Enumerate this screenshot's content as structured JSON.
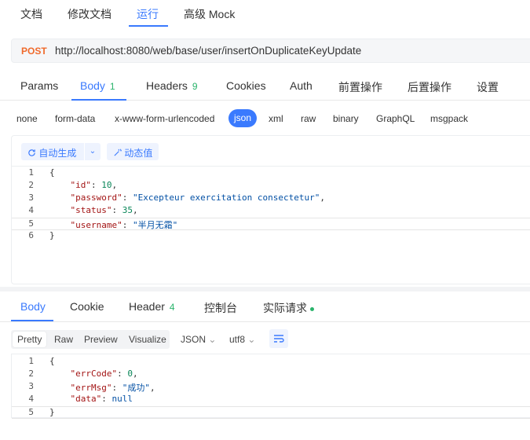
{
  "top_tabs": [
    "文档",
    "修改文档",
    "运行",
    "高级 Mock"
  ],
  "request": {
    "method": "POST",
    "url": "http://localhost:8080/web/base/user/insertOnDuplicateKeyUpdate"
  },
  "req_tabs": {
    "params": "Params",
    "body": "Body",
    "body_count": "1",
    "headers": "Headers",
    "headers_count": "9",
    "cookies": "Cookies",
    "auth": "Auth",
    "pre": "前置操作",
    "post": "后置操作",
    "settings": "设置"
  },
  "body_types": [
    "none",
    "form-data",
    "x-www-form-urlencoded",
    "json",
    "xml",
    "raw",
    "binary",
    "GraphQL",
    "msgpack"
  ],
  "editor_toolbar": {
    "auto_gen": "自动生成",
    "dynamic": "动态值"
  },
  "request_body": {
    "line_numbers": [
      "1",
      "2",
      "3",
      "4",
      "5",
      "6"
    ],
    "open": "{",
    "close": "}",
    "k_id": "\"id\"",
    "v_id": "10",
    "k_password": "\"password\"",
    "v_password": "\"Excepteur exercitation consectetur\"",
    "k_status": "\"status\"",
    "v_status": "35",
    "k_username": "\"username\"",
    "v_username": "\"半月无霜\""
  },
  "resp_tabs": {
    "body": "Body",
    "cookie": "Cookie",
    "header": "Header",
    "header_count": "4",
    "console": "控制台",
    "actual": "实际请求"
  },
  "view_options": [
    "Pretty",
    "Raw",
    "Preview",
    "Visualize"
  ],
  "format": "JSON",
  "encoding": "utf8",
  "response_body": {
    "line_numbers": [
      "1",
      "2",
      "3",
      "4",
      "5"
    ],
    "open": "{",
    "close": "}",
    "k_err": "\"errCode\"",
    "v_err": "0",
    "k_msg": "\"errMsg\"",
    "v_msg": "\"成功\"",
    "k_data": "\"data\"",
    "v_data": "null"
  },
  "colors": {
    "accent": "#3a7afe",
    "method": "#f06a2c",
    "count": "#29b36b"
  }
}
